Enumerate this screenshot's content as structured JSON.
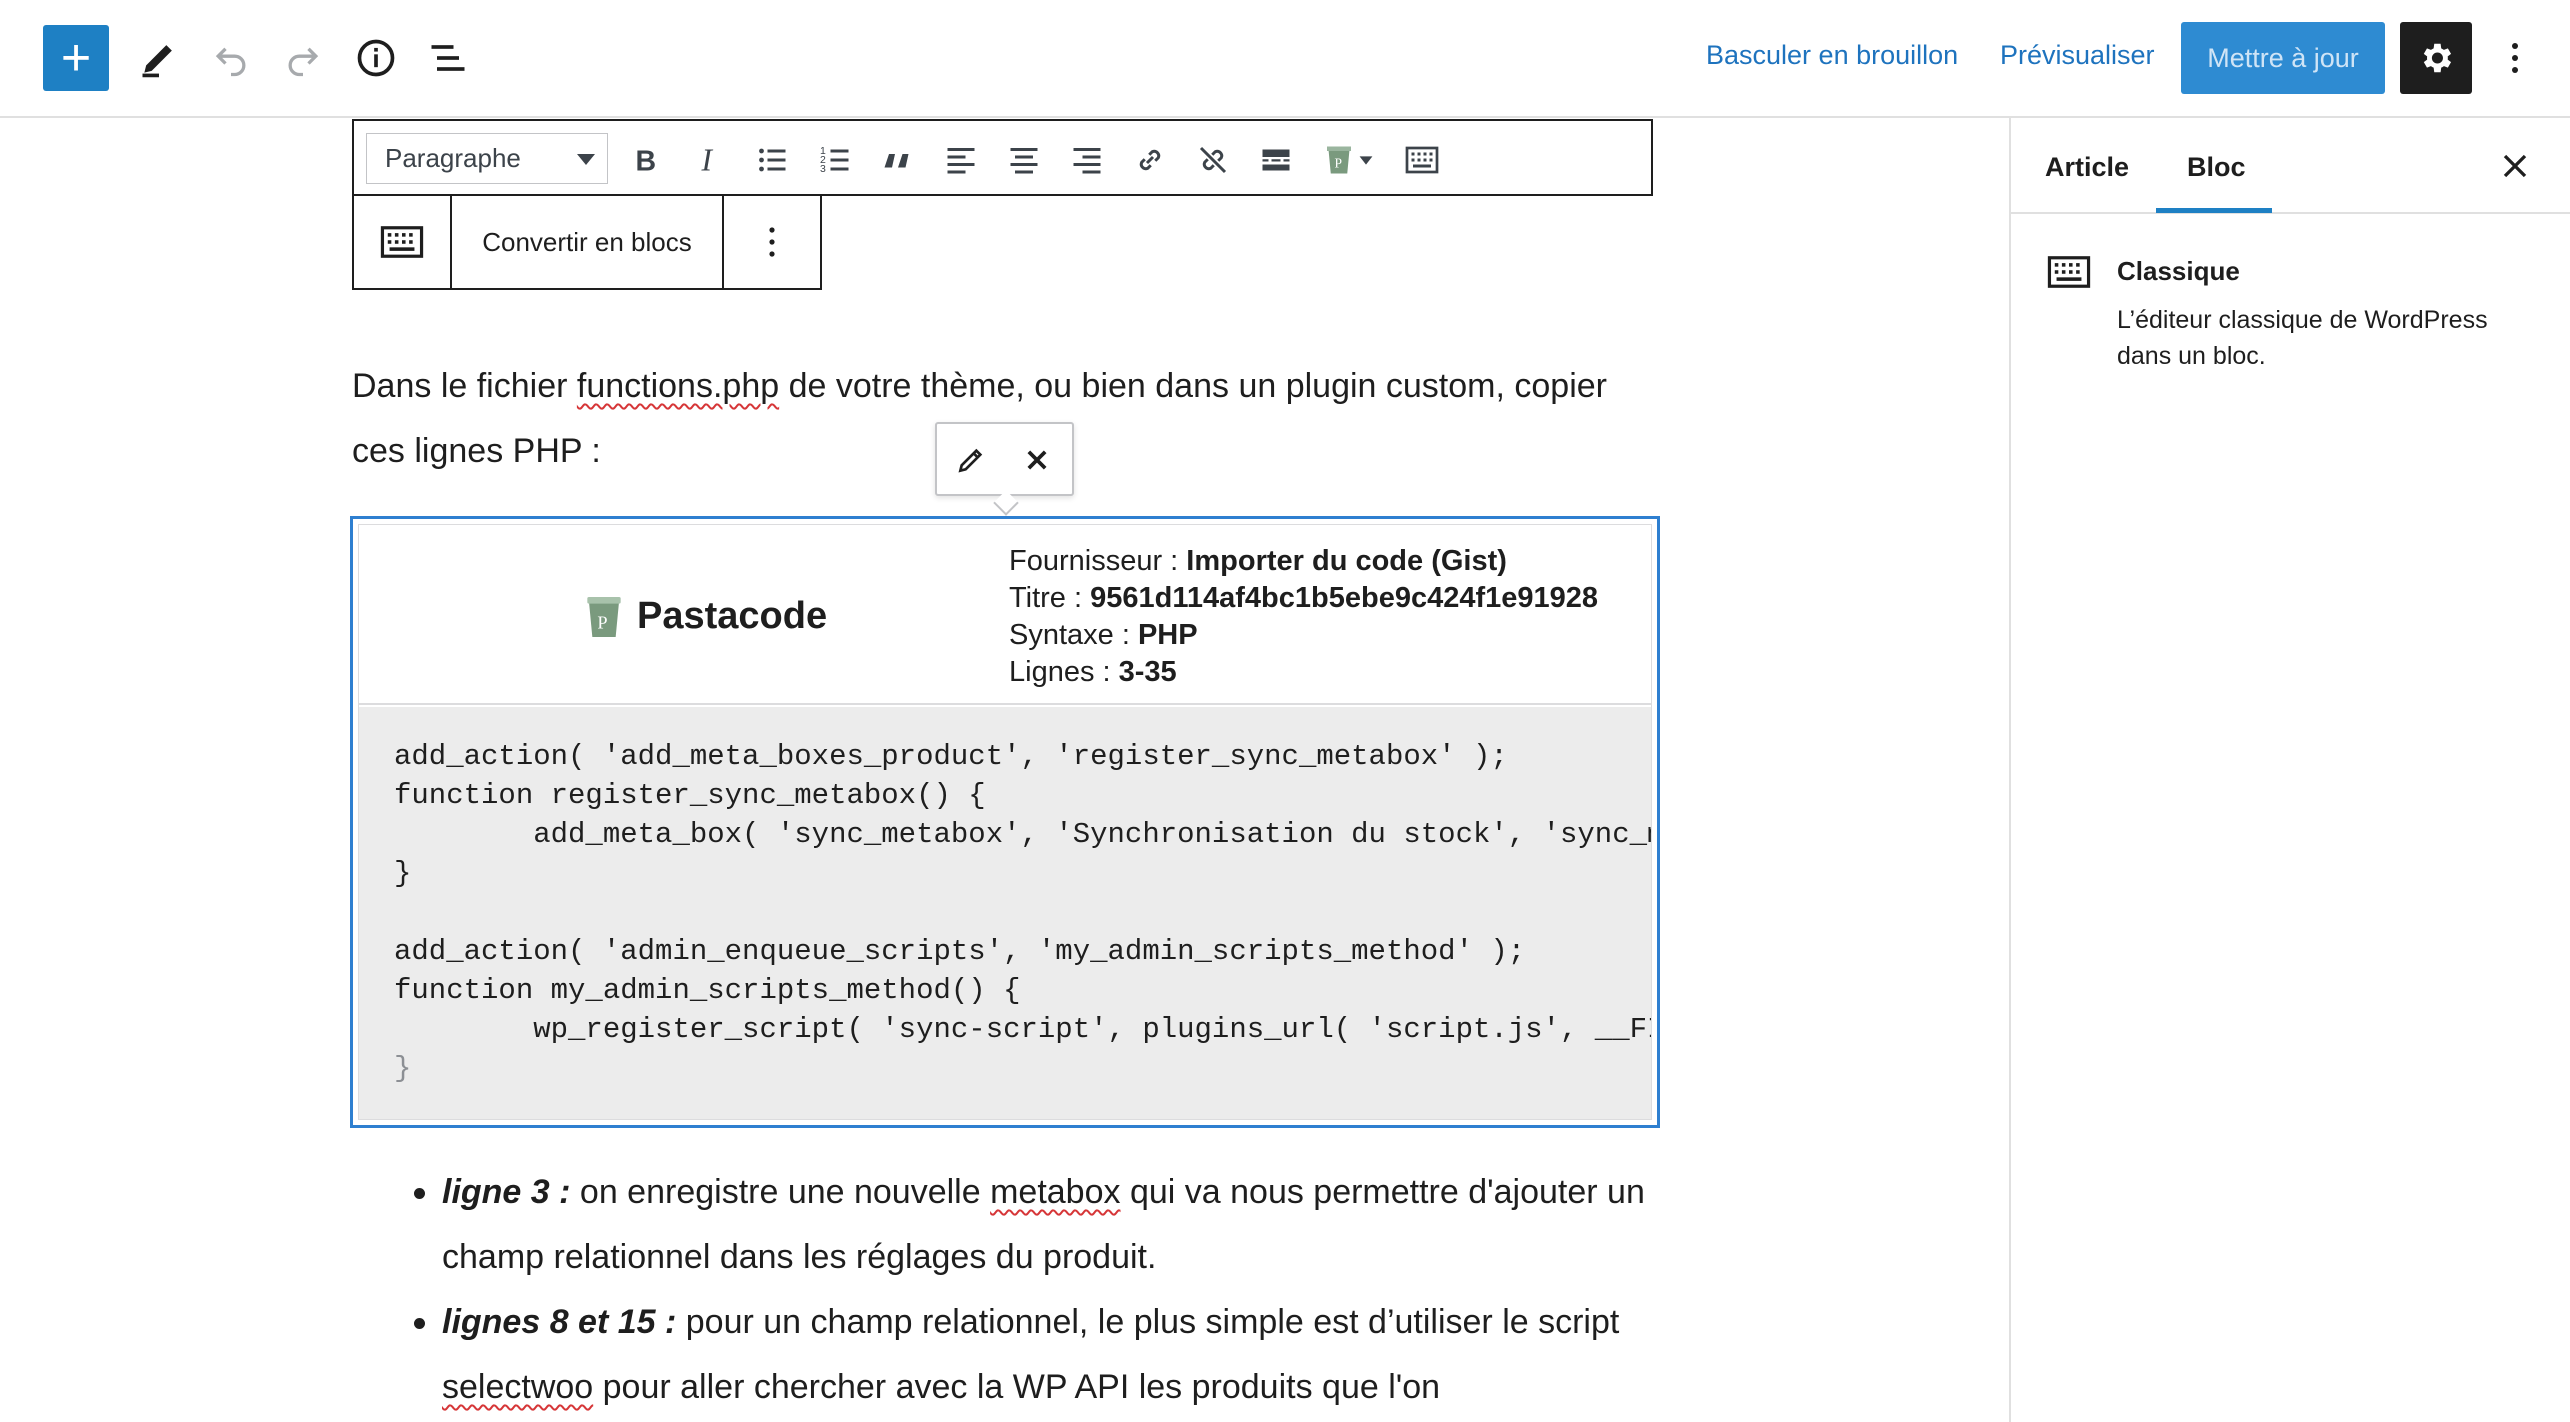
{
  "topbar": {
    "add_label": "+",
    "switch_draft": "Basculer en brouillon",
    "preview": "Prévisualiser",
    "update": "Mettre à jour"
  },
  "classic_toolbar": {
    "format_select": "Paragraphe",
    "buttons": [
      "bold-icon",
      "italic-icon",
      "bullet-list-icon",
      "numbered-list-icon",
      "quote-icon",
      "align-left-icon",
      "align-center-icon",
      "align-right-icon",
      "link-icon",
      "unlink-icon",
      "read-more-icon",
      "pastacode-icon",
      "toolbar-toggle-icon"
    ]
  },
  "block_toolbar": {
    "convert": "Convertir en blocs"
  },
  "content": {
    "paragraph_before": "Dans le fichier ",
    "paragraph_file": "functions.php",
    "paragraph_after": " de votre thème, ou bien dans un plugin custom, copier ces lignes PHP :"
  },
  "pastacode": {
    "name": "Pastacode",
    "provider_label": "Fournisseur : ",
    "provider_value": "Importer du code (Gist)",
    "title_label": "Titre : ",
    "title_value": "9561d114af4bc1b5ebe9c424f1e91928",
    "syntax_label": "Syntaxe : ",
    "syntax_value": "PHP",
    "lines_label": "Lignes : ",
    "lines_value": "3-35",
    "code": [
      "add_action( 'add_meta_boxes_product', 'register_sync_metabox' );",
      "function register_sync_metabox() {",
      "        add_meta_box( 'sync_metabox', 'Synchronisation du stock', 'sync_m",
      "}",
      "",
      "add_action( 'admin_enqueue_scripts', 'my_admin_scripts_method' );",
      "function my_admin_scripts_method() {",
      "        wp_register_script( 'sync-script', plugins_url( 'script.js', __FI",
      "}"
    ]
  },
  "bullets": [
    {
      "lead": "ligne 3 :",
      "text_before": " on enregistre une nouvelle ",
      "squiggle": "metabox",
      "text_after": " qui va nous permettre d'ajouter un champ relationnel dans les réglages du produit."
    },
    {
      "lead": "lignes 8 et 15 :",
      "text_before": " pour un champ relationnel, le plus simple est d’utiliser le script ",
      "squiggle": "selectwoo",
      "text_after": " pour aller chercher avec la WP API les produits que l'on"
    }
  ],
  "sidebar": {
    "tab_article": "Article",
    "tab_block": "Bloc",
    "block_title": "Classique",
    "block_desc": "L’éditeur classique de WordPress dans un bloc."
  },
  "colors": {
    "accent": "#1e80c4",
    "update_button": "#2e8bd2",
    "link": "#1e73be",
    "selected_outline": "#2e7fd0"
  }
}
